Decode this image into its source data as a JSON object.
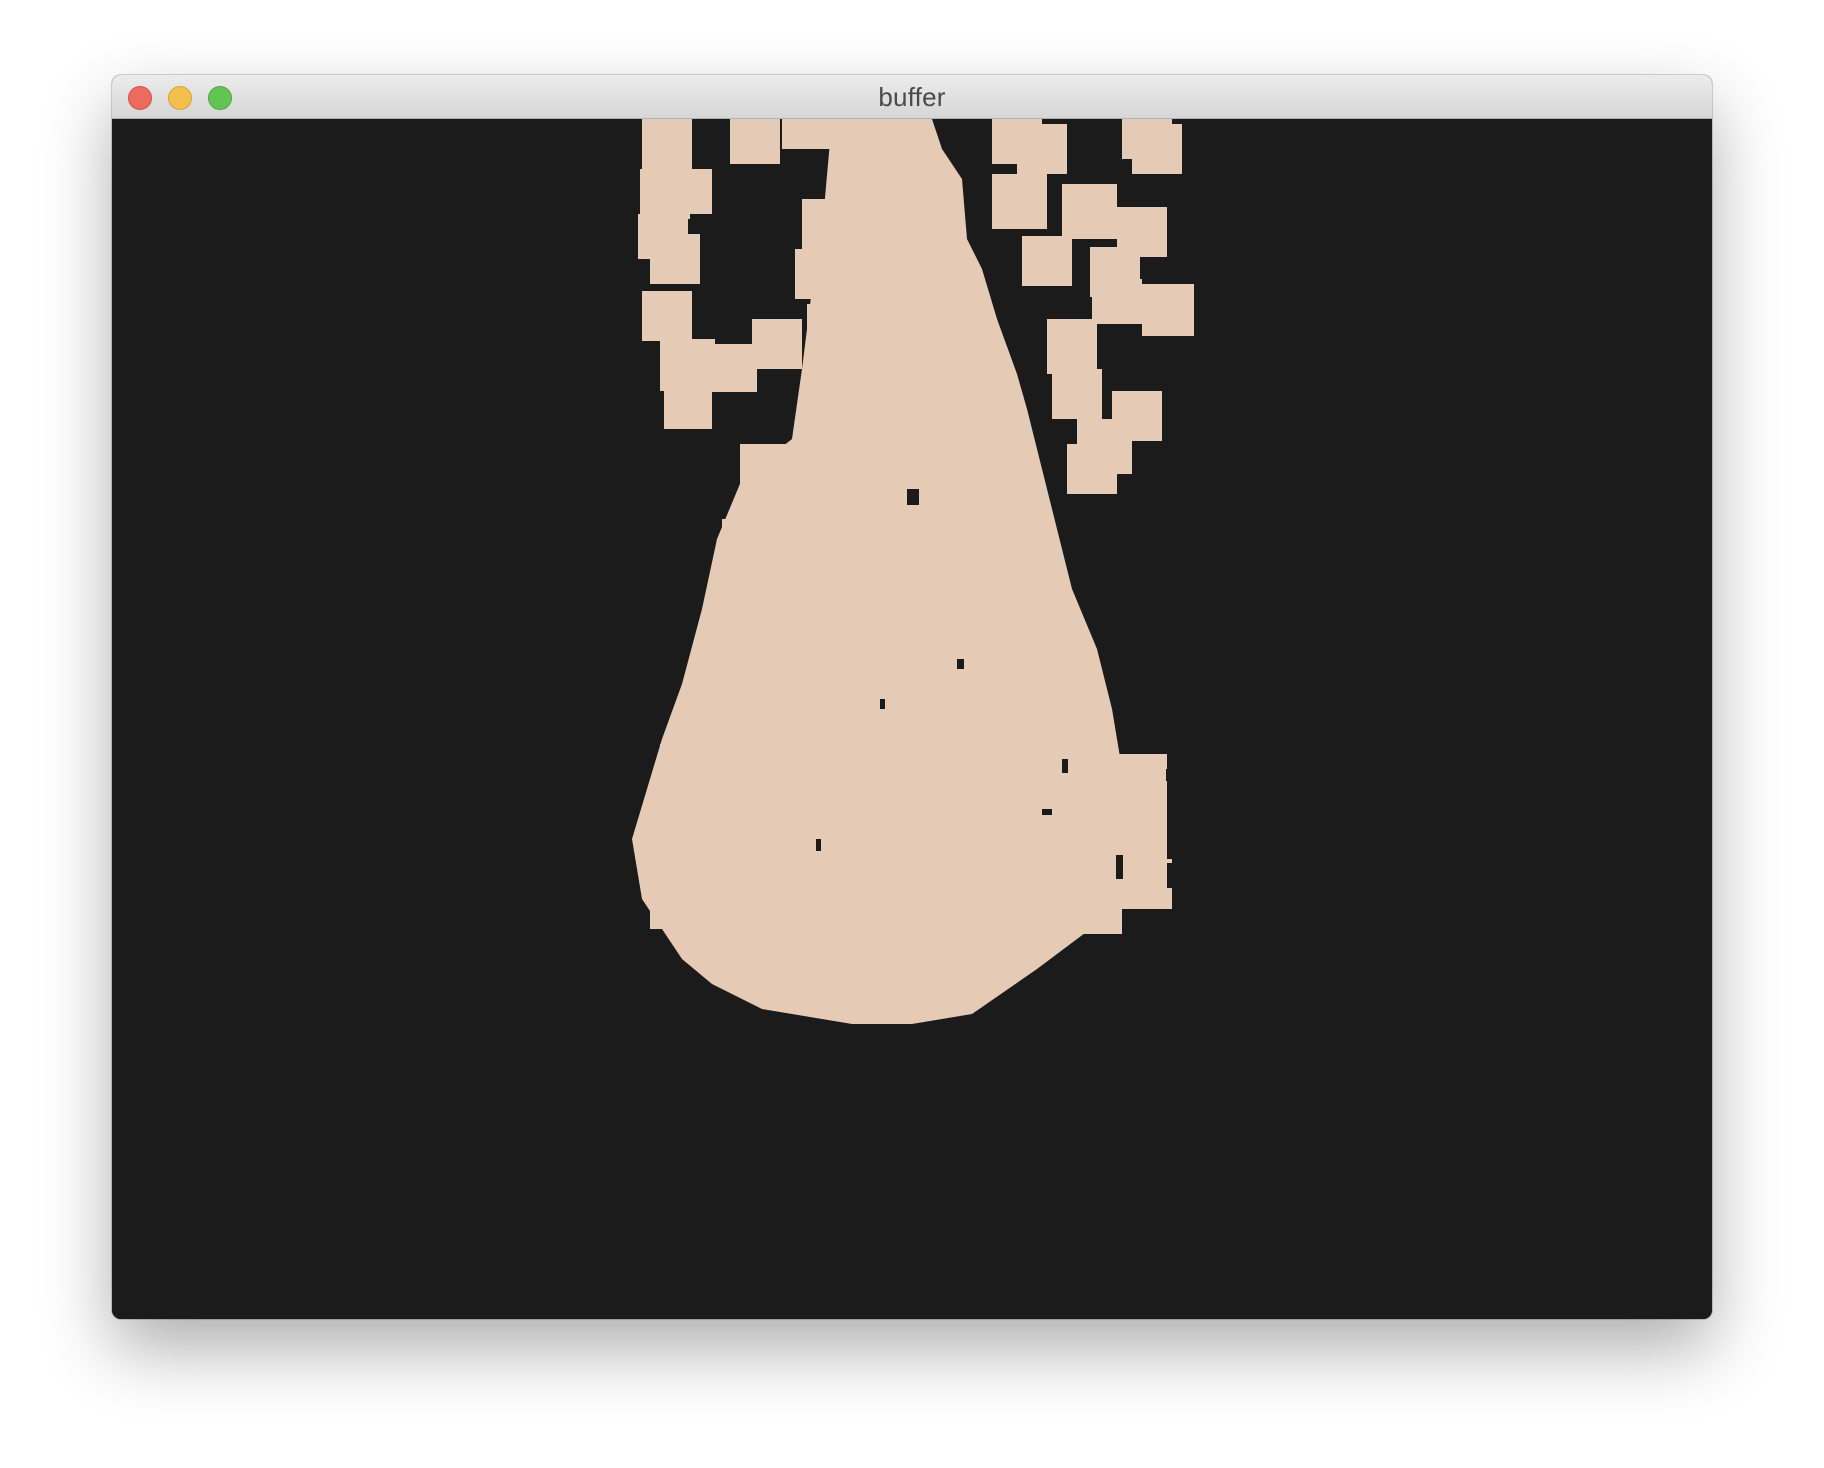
{
  "window": {
    "title": "buffer"
  },
  "traffic_lights": [
    {
      "name": "close-button",
      "color": "#ed6a5e",
      "border": "#d2524a"
    },
    {
      "name": "minimize-button",
      "color": "#f5bf4f",
      "border": "#d6a23c"
    },
    {
      "name": "zoom-button",
      "color": "#61c554",
      "border": "#4fa940"
    }
  ],
  "colors": {
    "canvas_background": "#1b1b1b",
    "splat": "#e5cbb5"
  }
}
